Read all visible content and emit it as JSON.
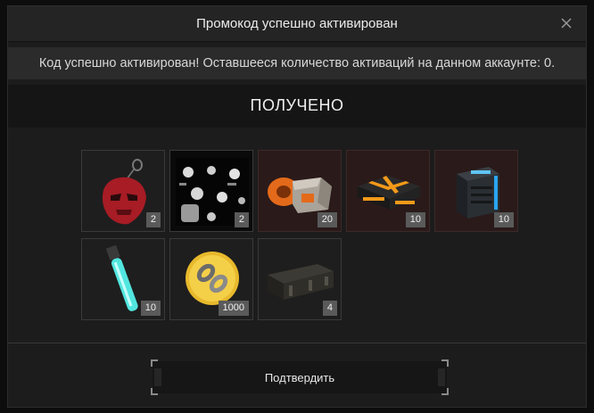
{
  "dialog": {
    "title": "Промокод успешно активирован",
    "message": "Код успешно активирован! Оставшееся количество активаций на данном аккаунте: 0.",
    "received_label": "ПОЛУЧЕНО",
    "confirm_label": "Подтвердить"
  },
  "items": [
    {
      "icon": "red-mask-pendant-icon",
      "count": "2",
      "rarity": "red"
    },
    {
      "icon": "skull-pattern-icon",
      "count": "2",
      "rarity": "normal"
    },
    {
      "icon": "orange-supply-crate-icon",
      "count": "20",
      "rarity": "red"
    },
    {
      "icon": "black-orange-case-icon",
      "count": "10",
      "rarity": "red"
    },
    {
      "icon": "blue-energy-box-icon",
      "count": "10",
      "rarity": "red"
    },
    {
      "icon": "cyan-vial-icon",
      "count": "10",
      "rarity": "normal"
    },
    {
      "icon": "gold-chain-coin-icon",
      "count": "1000",
      "rarity": "normal"
    },
    {
      "icon": "wooden-crate-icon",
      "count": "4",
      "rarity": "normal"
    }
  ],
  "colors": {
    "background": "#1c1c1c",
    "cell_red": "#2a1a1a",
    "count_badge": "#5a5a5a"
  }
}
